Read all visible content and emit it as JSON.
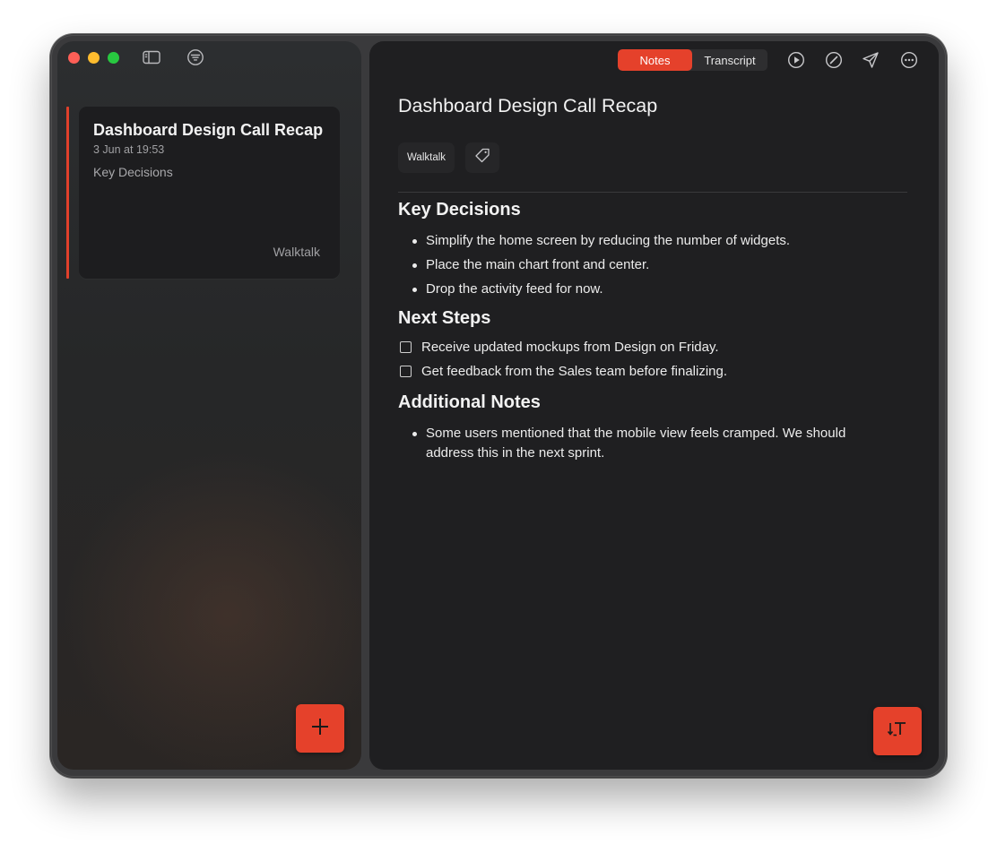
{
  "colors": {
    "accent": "#e5412b",
    "card_accent": "#e0402b",
    "main_bg": "#1f1f21",
    "text": "#f2f2f2"
  },
  "toolbar_left": {
    "sidebar_toggle_icon": "sidebar-icon",
    "filter_icon": "filter-icon"
  },
  "sidebar": {
    "note_card": {
      "title": "Dashboard Design Call Recap",
      "date": "3 Jun at 19:53",
      "snippet": "Key Decisions",
      "tag": "Walktalk"
    },
    "add_button_icon": "plus-icon"
  },
  "main": {
    "tabs": [
      {
        "label": "Notes",
        "active": true
      },
      {
        "label": "Transcript",
        "active": false
      }
    ],
    "toolbar_icons": [
      "play-icon",
      "compass-icon",
      "send-icon",
      "more-icon"
    ],
    "title": "Dashboard Design Call Recap",
    "tag": "Walktalk",
    "tag_add_icon": "tag-icon",
    "sections": {
      "key_decisions": {
        "heading": "Key Decisions",
        "items": [
          "Simplify the home screen by reducing the number of widgets.",
          "Place the main chart front and center.",
          "Drop the activity feed for now."
        ]
      },
      "next_steps": {
        "heading": "Next Steps",
        "items": [
          {
            "text": "Receive updated mockups from Design on Friday.",
            "checked": false
          },
          {
            "text": "Get feedback from the Sales team before finalizing.",
            "checked": false
          }
        ]
      },
      "additional_notes": {
        "heading": "Additional Notes",
        "items": [
          "Some users mentioned that the mobile view feels cramped. We should address this in the next sprint."
        ]
      }
    },
    "sort_button_icon": "sort-text-icon"
  }
}
